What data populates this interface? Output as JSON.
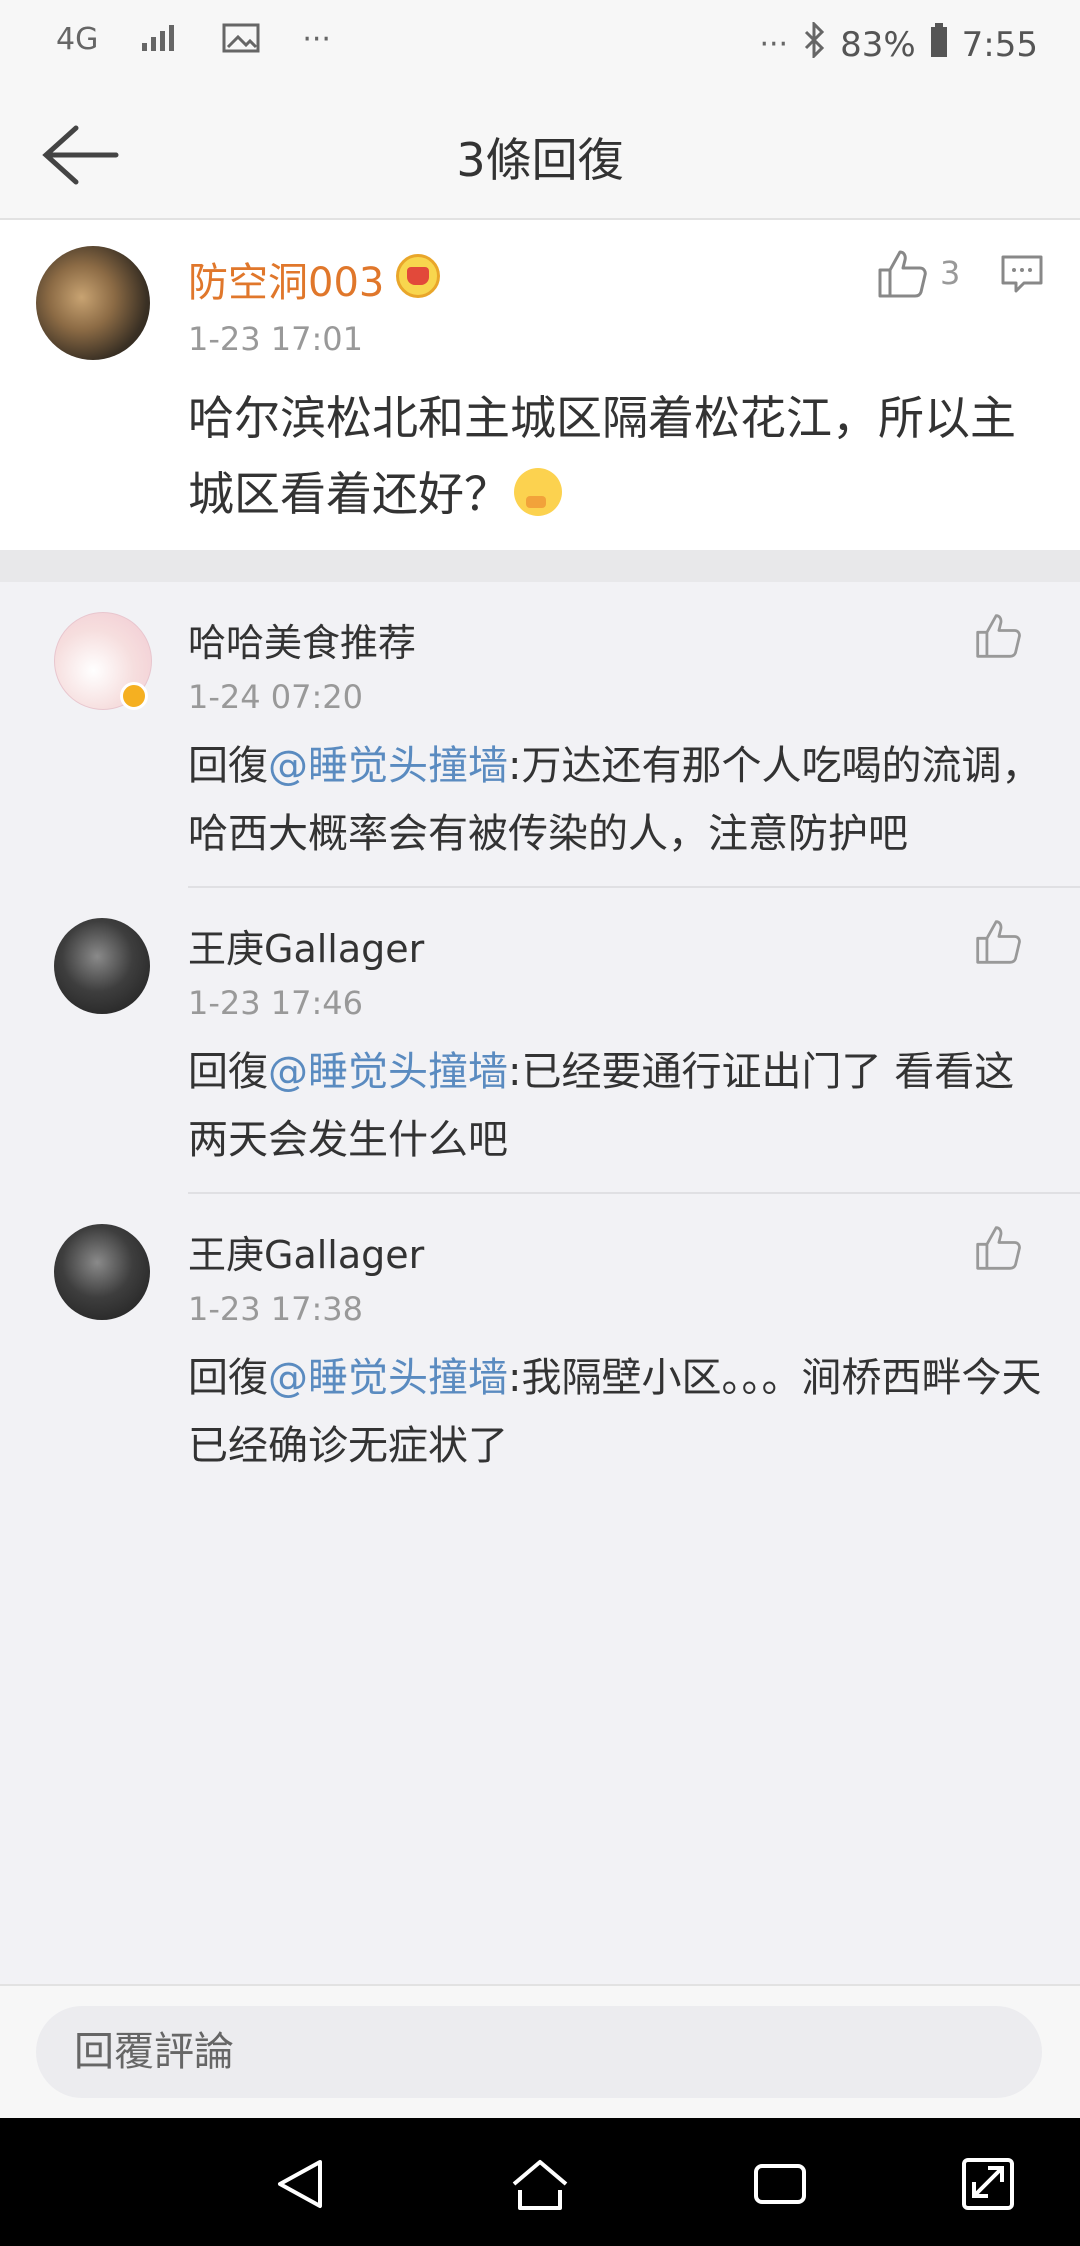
{
  "status_bar": {
    "network": "4G",
    "more_left": "···",
    "more_right": "···",
    "battery": "83%",
    "time": "7:55"
  },
  "nav": {
    "title": "3條回復"
  },
  "main_comment": {
    "username": "防空洞003",
    "time": "1-23 17:01",
    "text": "哈尔滨松北和主城区隔着松花江，所以主城区看着还好？",
    "like_count": "3"
  },
  "replies": [
    {
      "username": "哈哈美食推荐",
      "time": "1-24 07:20",
      "prefix": "回復",
      "mention": "@睡觉头撞墙",
      "text": ":万达还有那个人吃喝的流调，哈西大概率会有被传染的人，注意防护吧"
    },
    {
      "username": "王庚Gallager",
      "time": "1-23 17:46",
      "prefix": "回復",
      "mention": "@睡觉头撞墙",
      "text": ":已经要通行证出门了 看看这两天会发生什么吧"
    },
    {
      "username": "王庚Gallager",
      "time": "1-23 17:38",
      "prefix": "回復",
      "mention": "@睡觉头撞墙",
      "text": ":我隔壁小区。。。涧桥西畔今天已经确诊无症状了"
    }
  ],
  "bottom": {
    "input_placeholder": "回覆評論"
  },
  "colors": {
    "accent_username": "#e0772b",
    "mention": "#5a8bc0",
    "time_gray": "#999999"
  }
}
